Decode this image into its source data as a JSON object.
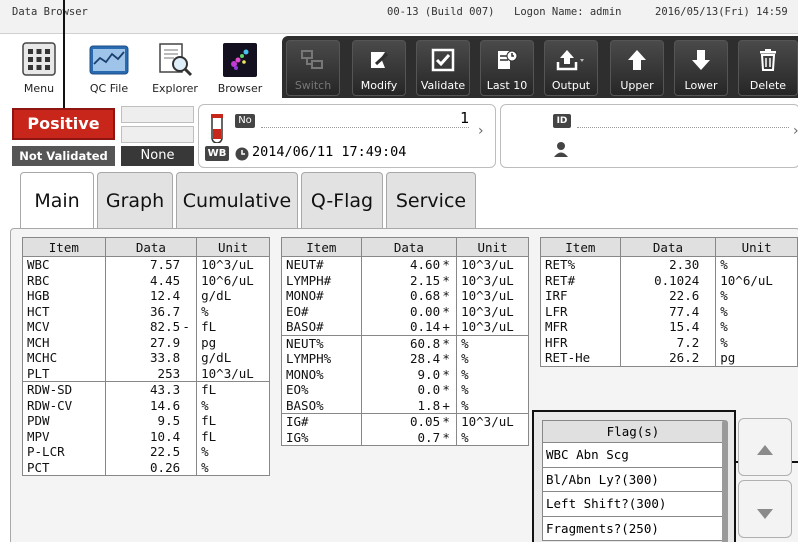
{
  "titlebar": {
    "app_name": "Data Browser",
    "build": "00-13 (Build 007)",
    "logon": "Logon Name: admin",
    "datetime": "2016/05/13(Fri) 14:59"
  },
  "launcher": [
    {
      "label": "Menu",
      "icon": "menu-grid-icon"
    },
    {
      "label": "QC File",
      "icon": "qc-file-icon"
    },
    {
      "label": "Explorer",
      "icon": "explorer-icon"
    },
    {
      "label": "Browser",
      "icon": "browser-icon"
    }
  ],
  "toolbar": [
    {
      "label": "Switch",
      "icon": "switch-icon",
      "enabled": false
    },
    {
      "label": "Modify",
      "icon": "modify-icon",
      "enabled": true
    },
    {
      "label": "Validate",
      "icon": "checkbox-icon",
      "enabled": true
    },
    {
      "label": "Last 10",
      "icon": "last-ten-icon",
      "enabled": true
    },
    {
      "label": "Output",
      "icon": "output-icon",
      "enabled": true
    },
    {
      "label": "Upper",
      "icon": "arrow-up-icon",
      "enabled": true
    },
    {
      "label": "Lower",
      "icon": "arrow-down-icon",
      "enabled": true
    },
    {
      "label": "Delete",
      "icon": "trash-icon",
      "enabled": true
    }
  ],
  "status": {
    "result": "Positive",
    "validation": "Not Validated",
    "extra": "None",
    "result_color": "#c8261b"
  },
  "sample": {
    "no_badge": "No",
    "number": "1",
    "mode_badge": "WB",
    "datetime": "2014/06/11 17:49:04"
  },
  "patient": {
    "id_badge": "ID"
  },
  "tabs": [
    "Main",
    "Graph",
    "Cumulative",
    "Q-Flag",
    "Service"
  ],
  "active_tab": "Main",
  "table_headers": [
    "Item",
    "Data",
    "Unit"
  ],
  "table1": [
    {
      "item": "WBC",
      "data": "7.57",
      "mark": "",
      "unit": "10^3/uL"
    },
    {
      "item": "RBC",
      "data": "4.45",
      "mark": "",
      "unit": "10^6/uL"
    },
    {
      "item": "HGB",
      "data": "12.4",
      "mark": "",
      "unit": "g/dL"
    },
    {
      "item": "HCT",
      "data": "36.7",
      "mark": "",
      "unit": "%"
    },
    {
      "item": "MCV",
      "data": "82.5",
      "mark": "-",
      "unit": "fL"
    },
    {
      "item": "MCH",
      "data": "27.9",
      "mark": "",
      "unit": "pg"
    },
    {
      "item": "MCHC",
      "data": "33.8",
      "mark": "",
      "unit": "g/dL"
    },
    {
      "item": "PLT",
      "data": "253",
      "mark": "",
      "unit": "10^3/uL"
    },
    {
      "item": "RDW-SD",
      "data": "43.3",
      "mark": "",
      "unit": "fL",
      "group_start": true
    },
    {
      "item": "RDW-CV",
      "data": "14.6",
      "mark": "",
      "unit": "%"
    },
    {
      "item": "PDW",
      "data": "9.5",
      "mark": "",
      "unit": "fL"
    },
    {
      "item": "MPV",
      "data": "10.4",
      "mark": "",
      "unit": "fL"
    },
    {
      "item": "P-LCR",
      "data": "22.5",
      "mark": "",
      "unit": "%"
    },
    {
      "item": "PCT",
      "data": "0.26",
      "mark": "",
      "unit": "%"
    }
  ],
  "table2": [
    {
      "item": "NEUT#",
      "data": "4.60",
      "mark": "*",
      "unit": "10^3/uL"
    },
    {
      "item": "LYMPH#",
      "data": "2.15",
      "mark": "*",
      "unit": "10^3/uL"
    },
    {
      "item": "MONO#",
      "data": "0.68",
      "mark": "*",
      "unit": "10^3/uL"
    },
    {
      "item": "EO#",
      "data": "0.00",
      "mark": "*",
      "unit": "10^3/uL"
    },
    {
      "item": "BASO#",
      "data": "0.14",
      "mark": "+",
      "unit": "10^3/uL"
    },
    {
      "item": "NEUT%",
      "data": "60.8",
      "mark": "*",
      "unit": "%",
      "group_start": true
    },
    {
      "item": "LYMPH%",
      "data": "28.4",
      "mark": "*",
      "unit": "%"
    },
    {
      "item": "MONO%",
      "data": "9.0",
      "mark": "*",
      "unit": "%"
    },
    {
      "item": "EO%",
      "data": "0.0",
      "mark": "*",
      "unit": "%"
    },
    {
      "item": "BASO%",
      "data": "1.8",
      "mark": "+",
      "unit": "%"
    },
    {
      "item": "IG#",
      "data": "0.05",
      "mark": "*",
      "unit": "10^3/uL",
      "group_start": true
    },
    {
      "item": "IG%",
      "data": "0.7",
      "mark": "*",
      "unit": "%"
    }
  ],
  "table3": [
    {
      "item": "RET%",
      "data": "2.30",
      "mark": "",
      "unit": "%"
    },
    {
      "item": "RET#",
      "data": "0.1024",
      "mark": "",
      "unit": "10^6/uL"
    },
    {
      "item": "IRF",
      "data": "22.6",
      "mark": "",
      "unit": "%"
    },
    {
      "item": "LFR",
      "data": "77.4",
      "mark": "",
      "unit": "%"
    },
    {
      "item": "MFR",
      "data": "15.4",
      "mark": "",
      "unit": "%"
    },
    {
      "item": "HFR",
      "data": "7.2",
      "mark": "",
      "unit": "%"
    },
    {
      "item": "RET-He",
      "data": "26.2",
      "mark": "",
      "unit": "pg"
    }
  ],
  "flags": {
    "header": "Flag(s)",
    "items": [
      "WBC Abn Scg",
      "Bl/Abn Ly?(300)",
      "Left Shift?(300)",
      "Fragments?(250)"
    ]
  },
  "scroll": {
    "up_icon": "scroll-up-icon",
    "down_icon": "scroll-down-icon"
  }
}
